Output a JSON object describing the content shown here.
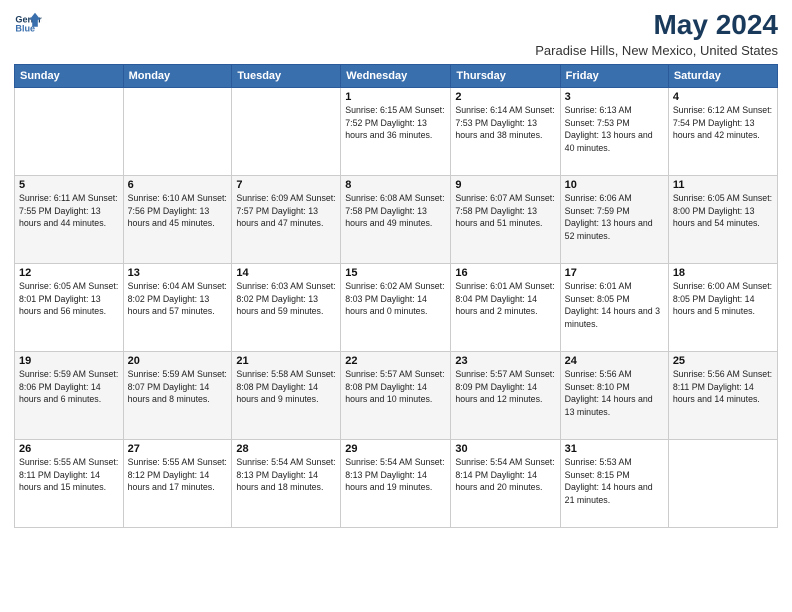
{
  "logo": {
    "line1": "General",
    "line2": "Blue"
  },
  "title": "May 2024",
  "subtitle": "Paradise Hills, New Mexico, United States",
  "weekdays": [
    "Sunday",
    "Monday",
    "Tuesday",
    "Wednesday",
    "Thursday",
    "Friday",
    "Saturday"
  ],
  "weeks": [
    [
      {
        "day": "",
        "info": ""
      },
      {
        "day": "",
        "info": ""
      },
      {
        "day": "",
        "info": ""
      },
      {
        "day": "1",
        "info": "Sunrise: 6:15 AM\nSunset: 7:52 PM\nDaylight: 13 hours\nand 36 minutes."
      },
      {
        "day": "2",
        "info": "Sunrise: 6:14 AM\nSunset: 7:53 PM\nDaylight: 13 hours\nand 38 minutes."
      },
      {
        "day": "3",
        "info": "Sunrise: 6:13 AM\nSunset: 7:53 PM\nDaylight: 13 hours\nand 40 minutes."
      },
      {
        "day": "4",
        "info": "Sunrise: 6:12 AM\nSunset: 7:54 PM\nDaylight: 13 hours\nand 42 minutes."
      }
    ],
    [
      {
        "day": "5",
        "info": "Sunrise: 6:11 AM\nSunset: 7:55 PM\nDaylight: 13 hours\nand 44 minutes."
      },
      {
        "day": "6",
        "info": "Sunrise: 6:10 AM\nSunset: 7:56 PM\nDaylight: 13 hours\nand 45 minutes."
      },
      {
        "day": "7",
        "info": "Sunrise: 6:09 AM\nSunset: 7:57 PM\nDaylight: 13 hours\nand 47 minutes."
      },
      {
        "day": "8",
        "info": "Sunrise: 6:08 AM\nSunset: 7:58 PM\nDaylight: 13 hours\nand 49 minutes."
      },
      {
        "day": "9",
        "info": "Sunrise: 6:07 AM\nSunset: 7:58 PM\nDaylight: 13 hours\nand 51 minutes."
      },
      {
        "day": "10",
        "info": "Sunrise: 6:06 AM\nSunset: 7:59 PM\nDaylight: 13 hours\nand 52 minutes."
      },
      {
        "day": "11",
        "info": "Sunrise: 6:05 AM\nSunset: 8:00 PM\nDaylight: 13 hours\nand 54 minutes."
      }
    ],
    [
      {
        "day": "12",
        "info": "Sunrise: 6:05 AM\nSunset: 8:01 PM\nDaylight: 13 hours\nand 56 minutes."
      },
      {
        "day": "13",
        "info": "Sunrise: 6:04 AM\nSunset: 8:02 PM\nDaylight: 13 hours\nand 57 minutes."
      },
      {
        "day": "14",
        "info": "Sunrise: 6:03 AM\nSunset: 8:02 PM\nDaylight: 13 hours\nand 59 minutes."
      },
      {
        "day": "15",
        "info": "Sunrise: 6:02 AM\nSunset: 8:03 PM\nDaylight: 14 hours\nand 0 minutes."
      },
      {
        "day": "16",
        "info": "Sunrise: 6:01 AM\nSunset: 8:04 PM\nDaylight: 14 hours\nand 2 minutes."
      },
      {
        "day": "17",
        "info": "Sunrise: 6:01 AM\nSunset: 8:05 PM\nDaylight: 14 hours\nand 3 minutes."
      },
      {
        "day": "18",
        "info": "Sunrise: 6:00 AM\nSunset: 8:05 PM\nDaylight: 14 hours\nand 5 minutes."
      }
    ],
    [
      {
        "day": "19",
        "info": "Sunrise: 5:59 AM\nSunset: 8:06 PM\nDaylight: 14 hours\nand 6 minutes."
      },
      {
        "day": "20",
        "info": "Sunrise: 5:59 AM\nSunset: 8:07 PM\nDaylight: 14 hours\nand 8 minutes."
      },
      {
        "day": "21",
        "info": "Sunrise: 5:58 AM\nSunset: 8:08 PM\nDaylight: 14 hours\nand 9 minutes."
      },
      {
        "day": "22",
        "info": "Sunrise: 5:57 AM\nSunset: 8:08 PM\nDaylight: 14 hours\nand 10 minutes."
      },
      {
        "day": "23",
        "info": "Sunrise: 5:57 AM\nSunset: 8:09 PM\nDaylight: 14 hours\nand 12 minutes."
      },
      {
        "day": "24",
        "info": "Sunrise: 5:56 AM\nSunset: 8:10 PM\nDaylight: 14 hours\nand 13 minutes."
      },
      {
        "day": "25",
        "info": "Sunrise: 5:56 AM\nSunset: 8:11 PM\nDaylight: 14 hours\nand 14 minutes."
      }
    ],
    [
      {
        "day": "26",
        "info": "Sunrise: 5:55 AM\nSunset: 8:11 PM\nDaylight: 14 hours\nand 15 minutes."
      },
      {
        "day": "27",
        "info": "Sunrise: 5:55 AM\nSunset: 8:12 PM\nDaylight: 14 hours\nand 17 minutes."
      },
      {
        "day": "28",
        "info": "Sunrise: 5:54 AM\nSunset: 8:13 PM\nDaylight: 14 hours\nand 18 minutes."
      },
      {
        "day": "29",
        "info": "Sunrise: 5:54 AM\nSunset: 8:13 PM\nDaylight: 14 hours\nand 19 minutes."
      },
      {
        "day": "30",
        "info": "Sunrise: 5:54 AM\nSunset: 8:14 PM\nDaylight: 14 hours\nand 20 minutes."
      },
      {
        "day": "31",
        "info": "Sunrise: 5:53 AM\nSunset: 8:15 PM\nDaylight: 14 hours\nand 21 minutes."
      },
      {
        "day": "",
        "info": ""
      }
    ]
  ]
}
